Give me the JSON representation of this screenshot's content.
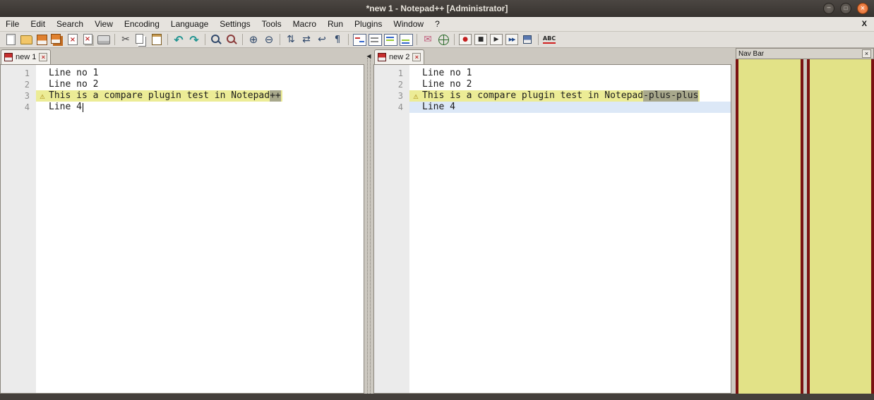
{
  "window": {
    "title": "*new 1 - Notepad++ [Administrator]"
  },
  "titlebar": {
    "controls": [
      "minimize",
      "maximize",
      "close"
    ]
  },
  "menu": {
    "items": [
      "File",
      "Edit",
      "Search",
      "View",
      "Encoding",
      "Language",
      "Settings",
      "Tools",
      "Macro",
      "Run",
      "Plugins",
      "Window",
      "?"
    ],
    "close_label": "X"
  },
  "toolbar": {
    "icons": [
      "new-file",
      "open-file",
      "save",
      "save-all",
      "close",
      "close-all",
      "print",
      "cut",
      "copy",
      "paste",
      "undo",
      "redo",
      "find",
      "replace",
      "zoom-in",
      "zoom-out",
      "sync-vertical-scroll",
      "sync-horizontal-scroll",
      "word-wrap",
      "show-all-characters",
      "compare",
      "clear-compare",
      "compare-first",
      "compare-last",
      "mail",
      "web",
      "record-macro",
      "stop-macro",
      "play-macro",
      "run-macro-multiple",
      "save-macro",
      "spell-check"
    ]
  },
  "panes": {
    "left": {
      "tab": {
        "label": "new 1",
        "modified": true
      },
      "lines": [
        {
          "num": "1",
          "text": "Line no 1"
        },
        {
          "num": "2",
          "text": "Line no 2"
        },
        {
          "num": "3",
          "text_pre": "This is a compare plugin test in Notepad",
          "text_diff": "++",
          "changed": true
        },
        {
          "num": "4",
          "text": "Line 4",
          "caret": true
        }
      ]
    },
    "right": {
      "tab": {
        "label": "new 2",
        "modified": true
      },
      "lines": [
        {
          "num": "1",
          "text": "Line no 1"
        },
        {
          "num": "2",
          "text": "Line no 2"
        },
        {
          "num": "3",
          "text_pre": "This is a compare plugin test in Notepad",
          "text_diff": "-plus-plus",
          "changed": true
        },
        {
          "num": "4",
          "text": "Line 4",
          "caret": false
        }
      ]
    }
  },
  "navbar": {
    "title": "Nav Bar"
  },
  "colors": {
    "changed_line_bg": "#ecec96",
    "diff_segment_bg": "#a8a88c",
    "caret_line_bg": "#dce8f7",
    "navbar_column_fill": "#e2e287",
    "navbar_column_border": "#7a1212",
    "close_button": "#e06b2c"
  }
}
